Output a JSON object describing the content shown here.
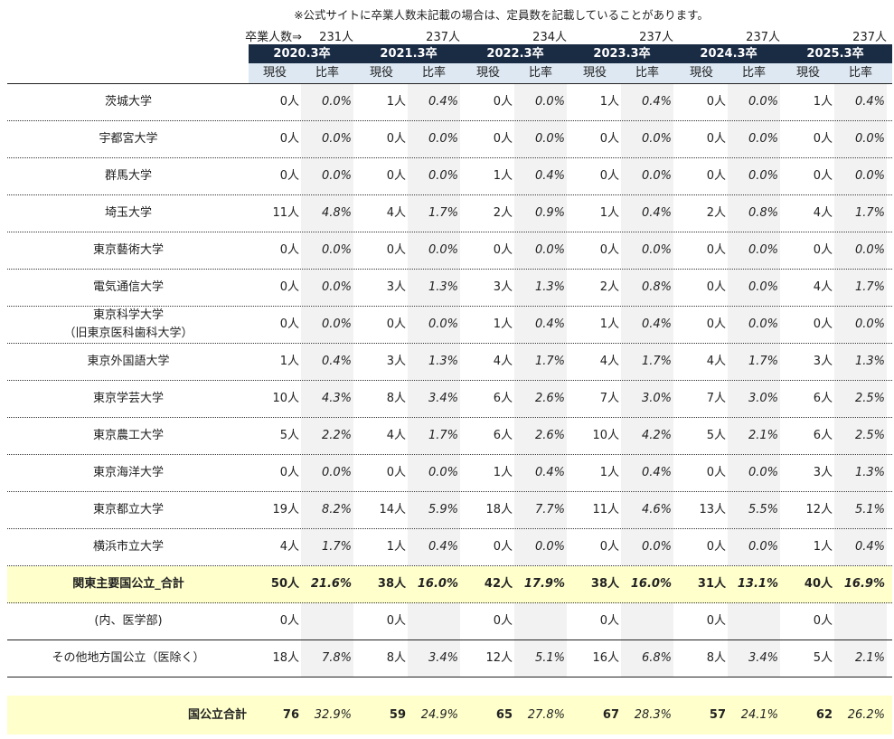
{
  "note": "※公式サイトに卒業人数未記載の場合は、定員数を記載していることがあります。",
  "graduates_label": "卒業人数⇒",
  "graduates": [
    "231人",
    "237人",
    "234人",
    "237人",
    "237人",
    "237人"
  ],
  "years": [
    "2020.3卒",
    "2021.3卒",
    "2022.3卒",
    "2023.3卒",
    "2024.3卒",
    "2025.3卒"
  ],
  "sub_headers": {
    "count": "現役",
    "rate": "比率"
  },
  "rows": [
    {
      "name": [
        "茨城大学"
      ],
      "cells": [
        [
          "0人",
          "0.0%"
        ],
        [
          "1人",
          "0.4%"
        ],
        [
          "0人",
          "0.0%"
        ],
        [
          "1人",
          "0.4%"
        ],
        [
          "0人",
          "0.0%"
        ],
        [
          "1人",
          "0.4%"
        ]
      ]
    },
    {
      "name": [
        "宇都宮大学"
      ],
      "cells": [
        [
          "0人",
          "0.0%"
        ],
        [
          "0人",
          "0.0%"
        ],
        [
          "0人",
          "0.0%"
        ],
        [
          "0人",
          "0.0%"
        ],
        [
          "0人",
          "0.0%"
        ],
        [
          "0人",
          "0.0%"
        ]
      ]
    },
    {
      "name": [
        "群馬大学"
      ],
      "cells": [
        [
          "0人",
          "0.0%"
        ],
        [
          "0人",
          "0.0%"
        ],
        [
          "1人",
          "0.4%"
        ],
        [
          "0人",
          "0.0%"
        ],
        [
          "0人",
          "0.0%"
        ],
        [
          "0人",
          "0.0%"
        ]
      ]
    },
    {
      "name": [
        "埼玉大学"
      ],
      "cells": [
        [
          "11人",
          "4.8%"
        ],
        [
          "4人",
          "1.7%"
        ],
        [
          "2人",
          "0.9%"
        ],
        [
          "1人",
          "0.4%"
        ],
        [
          "2人",
          "0.8%"
        ],
        [
          "4人",
          "1.7%"
        ]
      ]
    },
    {
      "name": [
        "東京藝術大学"
      ],
      "cells": [
        [
          "0人",
          "0.0%"
        ],
        [
          "0人",
          "0.0%"
        ],
        [
          "0人",
          "0.0%"
        ],
        [
          "0人",
          "0.0%"
        ],
        [
          "0人",
          "0.0%"
        ],
        [
          "0人",
          "0.0%"
        ]
      ]
    },
    {
      "name": [
        "電気通信大学"
      ],
      "cells": [
        [
          "0人",
          "0.0%"
        ],
        [
          "3人",
          "1.3%"
        ],
        [
          "3人",
          "1.3%"
        ],
        [
          "2人",
          "0.8%"
        ],
        [
          "0人",
          "0.0%"
        ],
        [
          "4人",
          "1.7%"
        ]
      ]
    },
    {
      "name": [
        "東京科学大学",
        "（旧東京医科歯科大学）"
      ],
      "cells": [
        [
          "0人",
          "0.0%"
        ],
        [
          "0人",
          "0.0%"
        ],
        [
          "1人",
          "0.4%"
        ],
        [
          "1人",
          "0.4%"
        ],
        [
          "0人",
          "0.0%"
        ],
        [
          "0人",
          "0.0%"
        ]
      ]
    },
    {
      "name": [
        "東京外国語大学"
      ],
      "cells": [
        [
          "1人",
          "0.4%"
        ],
        [
          "3人",
          "1.3%"
        ],
        [
          "4人",
          "1.7%"
        ],
        [
          "4人",
          "1.7%"
        ],
        [
          "4人",
          "1.7%"
        ],
        [
          "3人",
          "1.3%"
        ]
      ]
    },
    {
      "name": [
        "東京学芸大学"
      ],
      "cells": [
        [
          "10人",
          "4.3%"
        ],
        [
          "8人",
          "3.4%"
        ],
        [
          "6人",
          "2.6%"
        ],
        [
          "7人",
          "3.0%"
        ],
        [
          "7人",
          "3.0%"
        ],
        [
          "6人",
          "2.5%"
        ]
      ]
    },
    {
      "name": [
        "東京農工大学"
      ],
      "cells": [
        [
          "5人",
          "2.2%"
        ],
        [
          "4人",
          "1.7%"
        ],
        [
          "6人",
          "2.6%"
        ],
        [
          "10人",
          "4.2%"
        ],
        [
          "5人",
          "2.1%"
        ],
        [
          "6人",
          "2.5%"
        ]
      ]
    },
    {
      "name": [
        "東京海洋大学"
      ],
      "cells": [
        [
          "0人",
          "0.0%"
        ],
        [
          "0人",
          "0.0%"
        ],
        [
          "1人",
          "0.4%"
        ],
        [
          "1人",
          "0.4%"
        ],
        [
          "0人",
          "0.0%"
        ],
        [
          "3人",
          "1.3%"
        ]
      ]
    },
    {
      "name": [
        "東京都立大学"
      ],
      "cells": [
        [
          "19人",
          "8.2%"
        ],
        [
          "14人",
          "5.9%"
        ],
        [
          "18人",
          "7.7%"
        ],
        [
          "11人",
          "4.6%"
        ],
        [
          "13人",
          "5.5%"
        ],
        [
          "12人",
          "5.1%"
        ]
      ]
    },
    {
      "name": [
        "横浜市立大学"
      ],
      "cells": [
        [
          "4人",
          "1.7%"
        ],
        [
          "1人",
          "0.4%"
        ],
        [
          "0人",
          "0.0%"
        ],
        [
          "0人",
          "0.0%"
        ],
        [
          "0人",
          "0.0%"
        ],
        [
          "1人",
          "0.4%"
        ]
      ]
    },
    {
      "name": [
        "関東主要国公立_合計"
      ],
      "kind": "total",
      "cells": [
        [
          "50人",
          "21.6%"
        ],
        [
          "38人",
          "16.0%"
        ],
        [
          "42人",
          "17.9%"
        ],
        [
          "38人",
          "16.0%"
        ],
        [
          "31人",
          "13.1%"
        ],
        [
          "40人",
          "16.9%"
        ]
      ]
    },
    {
      "name": [
        "(内、医学部)"
      ],
      "kind": "sub",
      "cells": [
        [
          "0人",
          ""
        ],
        [
          "0人",
          ""
        ],
        [
          "0人",
          ""
        ],
        [
          "0人",
          ""
        ],
        [
          "0人",
          ""
        ],
        [
          "0人",
          ""
        ]
      ]
    },
    {
      "name": [
        "その他地方国公立（医除く）"
      ],
      "kind": "other",
      "cells": [
        [
          "18人",
          "7.8%"
        ],
        [
          "8人",
          "3.4%"
        ],
        [
          "12人",
          "5.1%"
        ],
        [
          "16人",
          "6.8%"
        ],
        [
          "8人",
          "3.4%"
        ],
        [
          "5人",
          "2.1%"
        ]
      ]
    }
  ],
  "grand_total": {
    "name": "国公立合計",
    "cells": [
      [
        "76",
        "32.9%"
      ],
      [
        "59",
        "24.9%"
      ],
      [
        "65",
        "27.8%"
      ],
      [
        "67",
        "28.3%"
      ],
      [
        "57",
        "24.1%"
      ],
      [
        "62",
        "26.2%"
      ]
    ]
  }
}
